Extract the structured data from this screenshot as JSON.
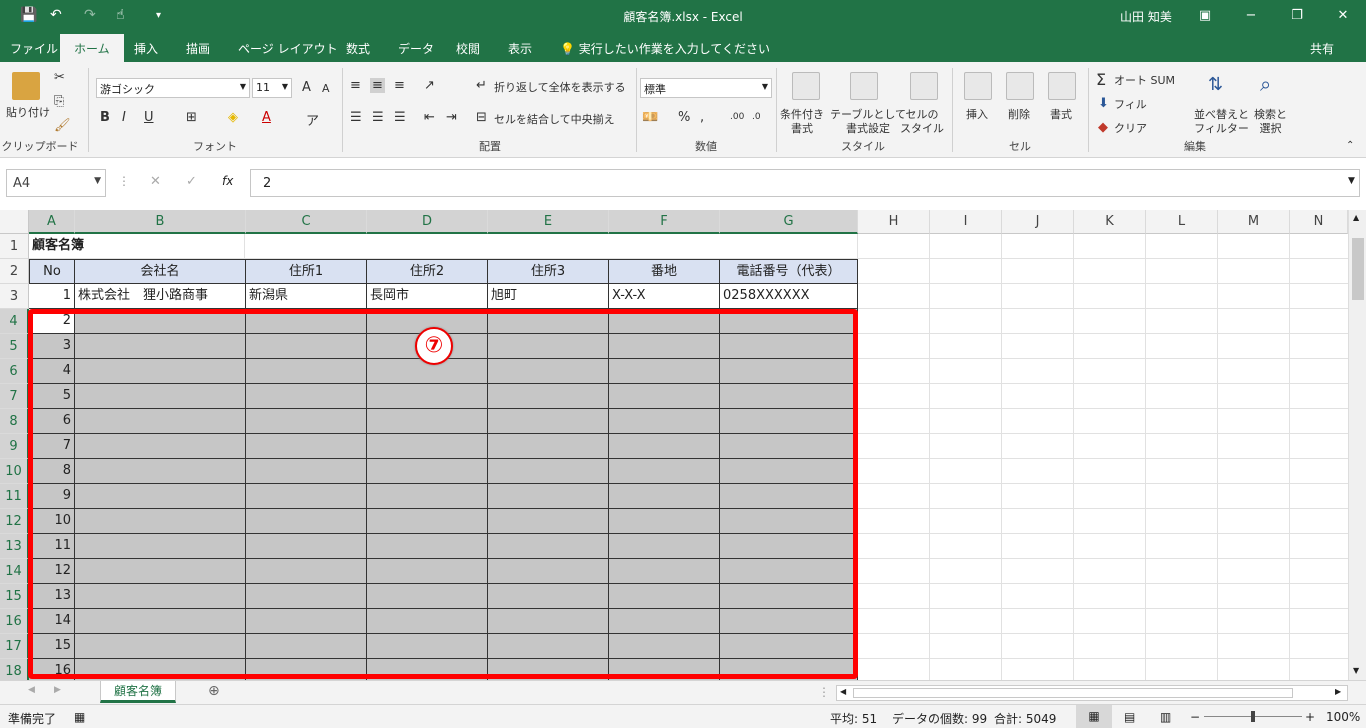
{
  "window": {
    "title": "顧客名簿.xlsx  -  Excel",
    "user": "山田 知美",
    "minimize": "−",
    "restore": "❐",
    "close": "✕"
  },
  "tabs": [
    "ファイル",
    "ホーム",
    "挿入",
    "描画",
    "ページ レイアウト",
    "数式",
    "データ",
    "校閲",
    "表示"
  ],
  "tellme": "実行したい作業を入力してください",
  "share": "共有",
  "ribbon": {
    "clipboard": {
      "label": "クリップボード",
      "paste": "貼り付け"
    },
    "font": {
      "label": "フォント",
      "name": "游ゴシック",
      "size": "11",
      "bold": "B",
      "italic": "I",
      "underline": "U"
    },
    "alignment": {
      "label": "配置",
      "wrap": "折り返して全体を表示する",
      "merge": "セルを結合して中央揃え"
    },
    "number": {
      "label": "数値",
      "format": "標準",
      "percent": "%"
    },
    "styles": {
      "label": "スタイル",
      "conditional": "条件付き\n書式",
      "table": "テーブルとして\n書式設定",
      "cell": "セルの\nスタイル"
    },
    "cells": {
      "label": "セル",
      "insert": "挿入",
      "delete": "削除",
      "format": "書式"
    },
    "editing": {
      "label": "編集",
      "autosum": "オート SUM",
      "fill": "フィル",
      "clear": "クリア",
      "sort": "並べ替えと\nフィルター",
      "find": "検索と\n選択"
    }
  },
  "formula_bar": {
    "name_box": "A4",
    "fx": "fx",
    "value": "2"
  },
  "columns": [
    "A",
    "B",
    "C",
    "D",
    "E",
    "F",
    "G",
    "H",
    "I",
    "J",
    "K",
    "L",
    "M",
    "N"
  ],
  "rows": [
    "1",
    "2",
    "3",
    "4",
    "5",
    "6",
    "7",
    "8",
    "9",
    "10",
    "11",
    "12",
    "13",
    "14",
    "15",
    "16",
    "17",
    "18"
  ],
  "sheet": {
    "title": "顧客名簿",
    "headers": [
      "No",
      "会社名",
      "住所1",
      "住所2",
      "住所3",
      "番地",
      "電話番号（代表）"
    ],
    "row3": [
      "1",
      "株式会社　狸小路商事",
      "新潟県",
      "長岡市",
      "旭町",
      "X-X-X",
      "0258XXXXXX"
    ],
    "numbers": [
      "2",
      "3",
      "4",
      "5",
      "6",
      "7",
      "8",
      "9",
      "10",
      "11",
      "12",
      "13",
      "14",
      "15",
      "16"
    ]
  },
  "annotation": "⑦",
  "sheet_tab": "顧客名簿",
  "status": {
    "ready": "準備完了",
    "average": "平均: 51",
    "count": "データの個数: 99",
    "sum": "合計: 5049",
    "zoom": "100%"
  }
}
